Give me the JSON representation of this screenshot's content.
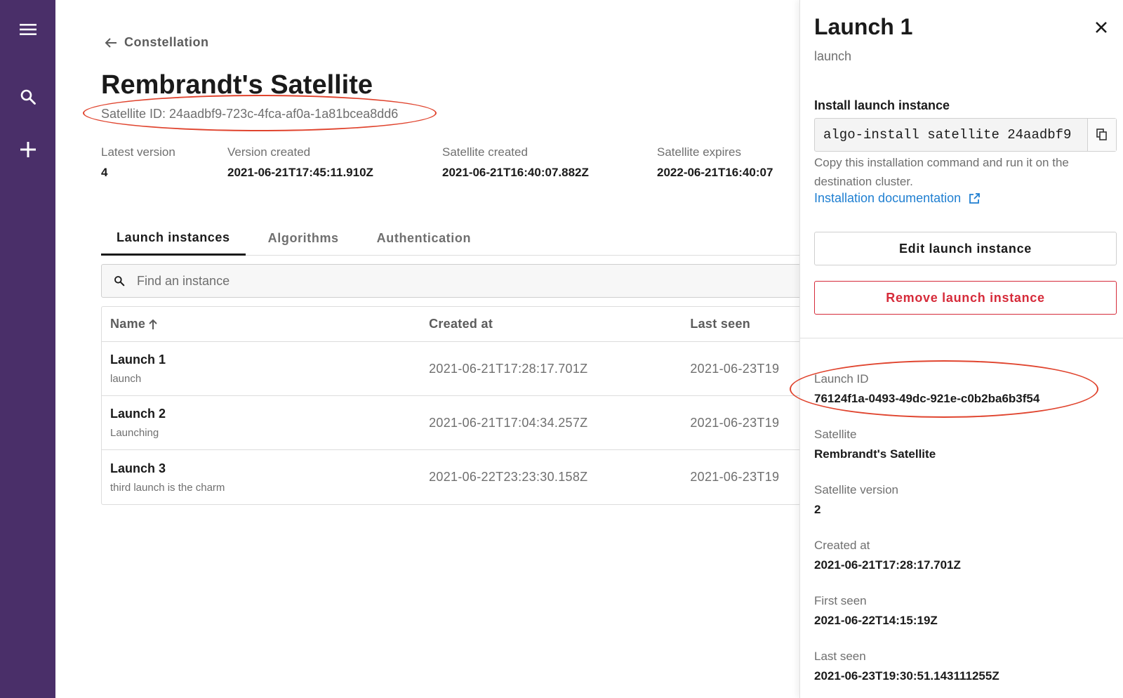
{
  "rail": {
    "icons": [
      "menu-icon",
      "search-icon",
      "plus-icon"
    ],
    "bg_color": "#4a2f69"
  },
  "header": {
    "back_label": "Constellation",
    "title": "Rembrandt's Satellite",
    "satellite_id": "Satellite ID: 24aadbf9-723c-4fca-af0a-1a81bcea8dd6"
  },
  "meta": [
    {
      "label": "Latest version",
      "value": "4"
    },
    {
      "label": "Version created",
      "value": "2021-06-21T17:45:11.910Z"
    },
    {
      "label": "Satellite created",
      "value": "2021-06-21T16:40:07.882Z"
    },
    {
      "label": "Satellite expires",
      "value": "2022-06-21T16:40:07"
    }
  ],
  "tabs": [
    {
      "label": "Launch instances",
      "active": true
    },
    {
      "label": "Algorithms",
      "active": false
    },
    {
      "label": "Authentication",
      "active": false
    }
  ],
  "search": {
    "placeholder": "Find an instance",
    "value": ""
  },
  "table": {
    "columns": [
      "Name",
      "Created at",
      "Last seen"
    ],
    "sort_icon": "arrow-up-icon",
    "rows": [
      {
        "name": "Launch 1",
        "desc": "launch",
        "created": "2021-06-21T17:28:17.701Z",
        "last_seen": "2021-06-23T19"
      },
      {
        "name": "Launch 2",
        "desc": "Launching",
        "created": "2021-06-21T17:04:34.257Z",
        "last_seen": "2021-06-23T19"
      },
      {
        "name": "Launch 3",
        "desc": "third launch is the charm",
        "created": "2021-06-22T23:23:30.158Z",
        "last_seen": "2021-06-23T19"
      }
    ]
  },
  "panel": {
    "title": "Launch 1",
    "subtitle": "launch",
    "install_label": "Install launch instance",
    "install_command": "algo-install satellite 24aadbf9",
    "help_text": "Copy this installation command and run it on the destination cluster.",
    "doc_link": "Installation documentation",
    "edit_label": "Edit launch instance",
    "remove_label": "Remove launch instance",
    "fields": [
      {
        "label": "Launch ID",
        "value": "76124f1a-0493-49dc-921e-c0b2ba6b3f54"
      },
      {
        "label": "Satellite",
        "value": "Rembrandt's Satellite"
      },
      {
        "label": "Satellite version",
        "value": "2"
      },
      {
        "label": "Created at",
        "value": "2021-06-21T17:28:17.701Z"
      },
      {
        "label": "First seen",
        "value": "2021-06-22T14:15:19Z"
      },
      {
        "label": "Last seen",
        "value": "2021-06-23T19:30:51.143111255Z"
      }
    ]
  },
  "colors": {
    "accent_link": "#1f7fd1",
    "danger": "#d62b3a",
    "annotation": "#e0442e"
  }
}
